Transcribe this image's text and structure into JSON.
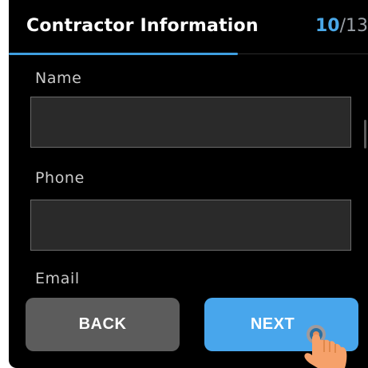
{
  "header": {
    "title": "Contractor Information",
    "step_current": "10",
    "step_separator": "/",
    "step_total": "13",
    "accent_color": "#4aa8e8"
  },
  "fields": {
    "name": {
      "label": "Name",
      "value": ""
    },
    "phone": {
      "label": "Phone",
      "value": ""
    },
    "email": {
      "label": "Email"
    }
  },
  "buttons": {
    "back_label": "BACK",
    "next_label": "NEXT"
  },
  "icons": {
    "pointer": "tap-hand-icon"
  }
}
